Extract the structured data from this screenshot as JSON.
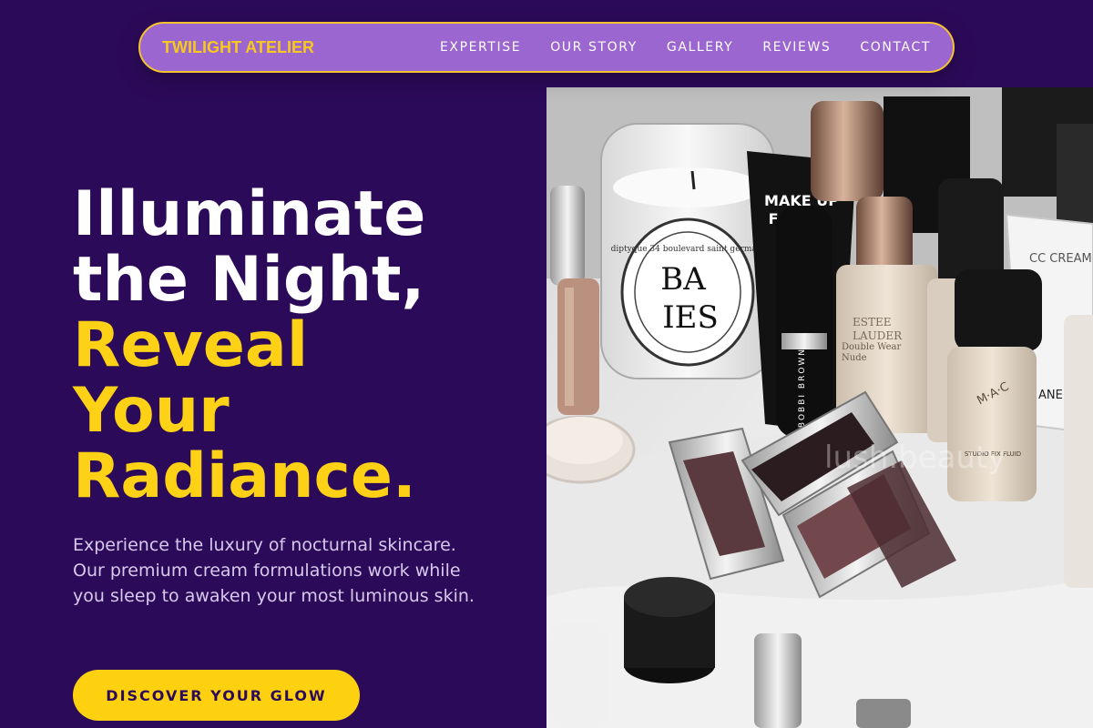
{
  "nav": {
    "brand": "TWILIGHT ATELIER",
    "links": [
      "EXPERTISE",
      "OUR STORY",
      "GALLERY",
      "REVIEWS",
      "CONTACT"
    ]
  },
  "hero": {
    "title_line1": "Illuminate",
    "title_line2": "the Night,",
    "title_line3": "Reveal",
    "title_line4": "Your",
    "title_line5": "Radiance.",
    "description": "Experience the luxury of nocturnal skincare. Our premium cream formulations work while you sleep to awaken your most luminous skin.",
    "cta_label": "DISCOVER YOUR GLOW"
  },
  "photo": {
    "candle_label_top": "diptyque 34 boulevard saint germain",
    "candle_text1": "BA",
    "candle_text2": "IES",
    "makeup_forever": "MAKE UP",
    "makeup_forever2": "FOR",
    "bobbi": "BOBBI BROWN",
    "estee1": "ESTEE",
    "estee2": "LAUDER",
    "estee_product": "Double Wear",
    "estee_product2": "Nude",
    "cc_cream": "CC CREAM",
    "mac": "M·A·C",
    "mac_product": "STUDIO FIX FLUID",
    "chanel_fragment": "ANEL",
    "watermark": "lush.beauty"
  },
  "colors": {
    "background": "#2c0a5a",
    "nav_bg": "#9b66cf",
    "accent": "#fcd116"
  }
}
